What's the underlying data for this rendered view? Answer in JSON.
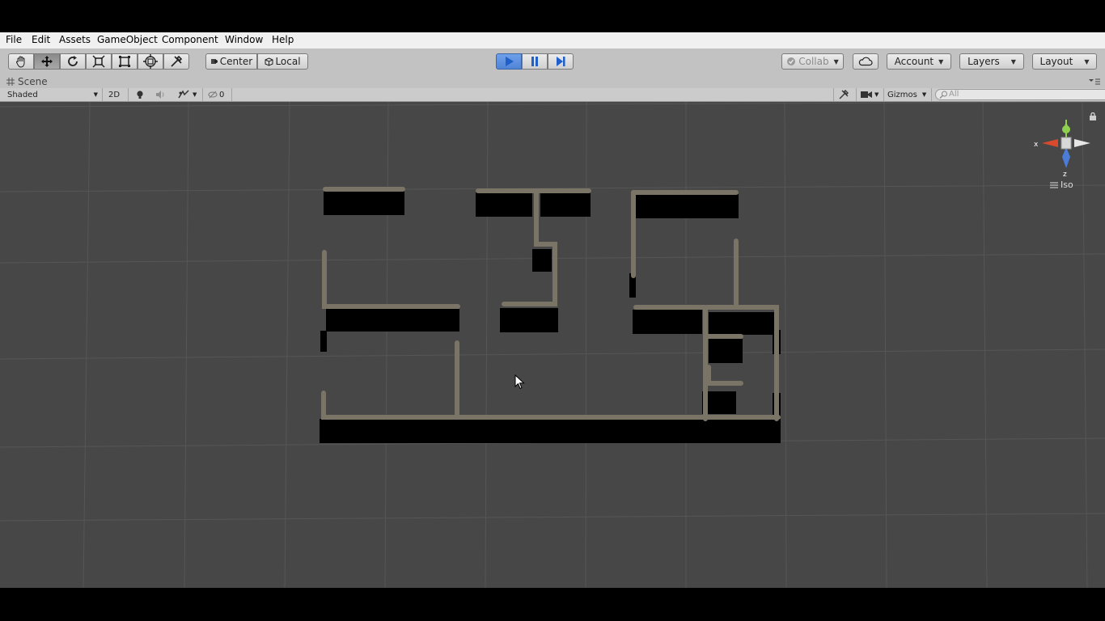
{
  "menu": [
    "File",
    "Edit",
    "Assets",
    "GameObject",
    "Component",
    "Window",
    "Help"
  ],
  "toolbar": {
    "tools": [
      "hand-tool",
      "move-tool",
      "rotate-tool",
      "scale-tool",
      "rect-tool",
      "transform-tool",
      "custom-tool"
    ],
    "center_label": "Center",
    "local_label": "Local",
    "collab_label": "Collab",
    "account_label": "Account",
    "layers_label": "Layers",
    "layout_label": "Layout",
    "accent": "#4f84d6"
  },
  "scene": {
    "tab_label": "Scene",
    "shading_mode": "Shaded",
    "mode_2d": "2D",
    "hidden_count": "0",
    "gizmos_label": "Gizmos",
    "search_placeholder": "All",
    "projection_label": "Iso",
    "axis_x": "x",
    "axis_z": "z",
    "bg_color": "#474747",
    "wall_color": "#7a7466",
    "block_color": "#000000"
  }
}
